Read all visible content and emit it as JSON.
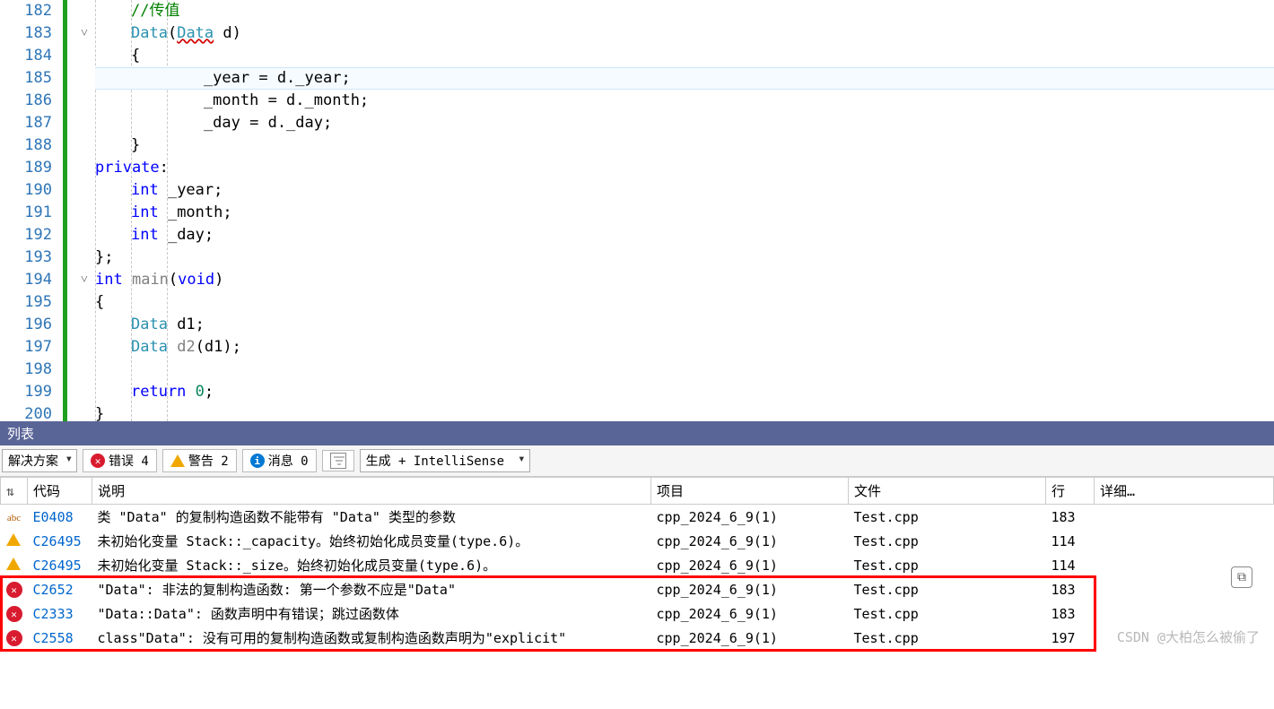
{
  "code": {
    "lines": [
      {
        "n": "182",
        "html": "<span class='k-comment'>//传值</span>"
      },
      {
        "n": "183",
        "html": "<span class='k-type'>Data</span>(<span class='k-typeerr'>Data</span> d)",
        "fold": "˅"
      },
      {
        "n": "184",
        "html": "{"
      },
      {
        "n": "185",
        "html": "    _year = d._year;",
        "hl": true
      },
      {
        "n": "186",
        "html": "    _month = d._month;"
      },
      {
        "n": "187",
        "html": "    _day = d._day;"
      },
      {
        "n": "188",
        "html": "}"
      },
      {
        "n": "189",
        "html": "<span class='k-keyword'>private</span>:"
      },
      {
        "n": "190",
        "html": "<span class='k-keyword'>int</span> _year;"
      },
      {
        "n": "191",
        "html": "<span class='k-keyword'>int</span> _month;"
      },
      {
        "n": "192",
        "html": "<span class='k-keyword'>int</span> _day;"
      },
      {
        "n": "193",
        "html": "};"
      },
      {
        "n": "194",
        "html": "<span class='k-keyword'>int</span> <span class='k-gray'>main</span>(<span class='k-keyword'>void</span>)",
        "fold": "˅"
      },
      {
        "n": "195",
        "html": "{"
      },
      {
        "n": "196",
        "html": "<span class='k-type'>Data</span> d1;"
      },
      {
        "n": "197",
        "html": "<span class='k-type'>Data</span> <span class='k-gray'>d2</span>(d1);"
      },
      {
        "n": "198",
        "html": ""
      },
      {
        "n": "199",
        "html": "<span class='k-keyword'>return</span> <span class='k-num'>0</span>;"
      },
      {
        "n": "200",
        "html": "}"
      }
    ],
    "indents": [
      1,
      1,
      1,
      2,
      2,
      2,
      1,
      0,
      1,
      1,
      1,
      0,
      0,
      0,
      1,
      1,
      0,
      1,
      0
    ]
  },
  "panel": {
    "title": "列表",
    "toolbar": {
      "scope": "解决方案",
      "errors_label": "错误 4",
      "warnings_label": "警告 2",
      "info_label": "消息 0",
      "source": "生成 + IntelliSense"
    },
    "headers": {
      "icon": "",
      "code": "代码",
      "desc": "说明",
      "project": "项目",
      "file": "文件",
      "line": "行",
      "detail": "详细…"
    },
    "rows": [
      {
        "sev": "abc",
        "code": "E0408",
        "desc": "类 \"Data\" 的复制构造函数不能带有 \"Data\" 类型的参数",
        "project": "cpp_2024_6_9(1)",
        "file": "Test.cpp",
        "line": "183"
      },
      {
        "sev": "warn",
        "code": "C26495",
        "desc": "未初始化变量 Stack::_capacity。始终初始化成员变量(type.6)。",
        "project": "cpp_2024_6_9(1)",
        "file": "Test.cpp",
        "line": "114"
      },
      {
        "sev": "warn",
        "code": "C26495",
        "desc": "未初始化变量 Stack::_size。始终初始化成员变量(type.6)。",
        "project": "cpp_2024_6_9(1)",
        "file": "Test.cpp",
        "line": "114"
      },
      {
        "sev": "err",
        "code": "C2652",
        "desc": "\"Data\": 非法的复制构造函数: 第一个参数不应是\"Data\"",
        "project": "cpp_2024_6_9(1)",
        "file": "Test.cpp",
        "line": "183",
        "boxed": true
      },
      {
        "sev": "err",
        "code": "C2333",
        "desc": "\"Data::Data\": 函数声明中有错误；跳过函数体",
        "project": "cpp_2024_6_9(1)",
        "file": "Test.cpp",
        "line": "183",
        "boxed": true
      },
      {
        "sev": "err",
        "code": "C2558",
        "desc": "class\"Data\": 没有可用的复制构造函数或复制构造函数声明为\"explicit\"",
        "project": "cpp_2024_6_9(1)",
        "file": "Test.cpp",
        "line": "197",
        "boxed": true
      }
    ]
  },
  "watermark": "CSDN @大柏怎么被偷了"
}
